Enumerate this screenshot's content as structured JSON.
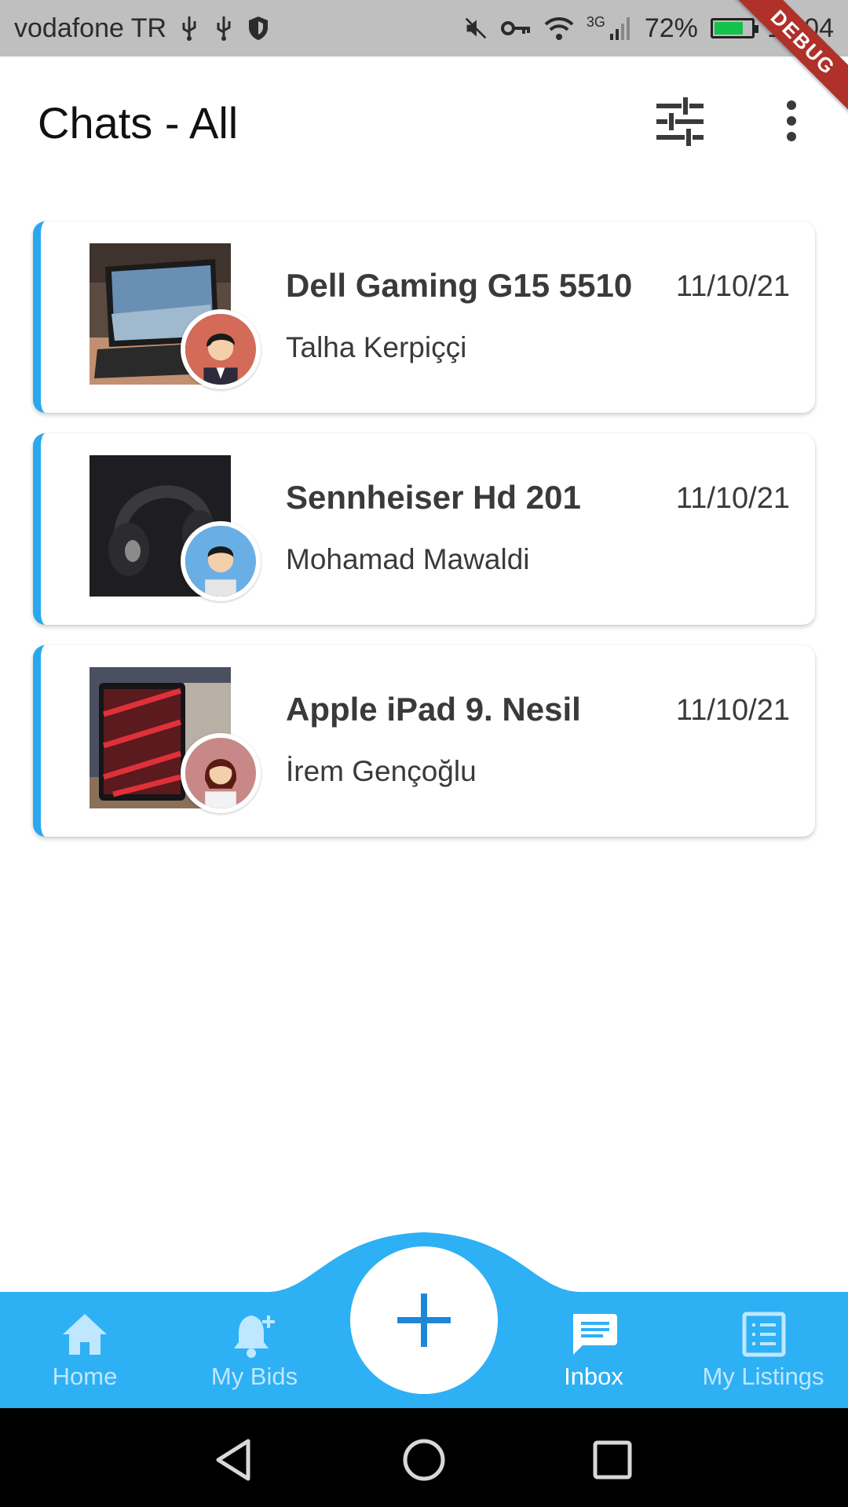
{
  "status_bar": {
    "carrier": "vodafone TR",
    "network": "3G",
    "battery_percent": "72%",
    "time": "19:04",
    "debug_label": "DEBUG"
  },
  "header": {
    "title": "Chats - All",
    "filter_icon": "tune-icon",
    "more_icon": "more-vert-icon"
  },
  "chats": [
    {
      "title": "Dell Gaming G15 5510",
      "user": "Talha Kerpiççi",
      "date": "11/10/21"
    },
    {
      "title": "Sennheiser Hd 201",
      "user": "Mohamad Mawaldi",
      "date": "11/10/21"
    },
    {
      "title": "Apple iPad 9. Nesil",
      "user": "İrem Gençoğlu",
      "date": "11/10/21"
    }
  ],
  "bottom_nav": {
    "items": [
      {
        "label": "Home",
        "icon": "home-icon"
      },
      {
        "label": "My Bids",
        "icon": "bell-plus-icon"
      },
      {
        "label": "Inbox",
        "icon": "chat-icon",
        "active": true
      },
      {
        "label": "My Listings",
        "icon": "list-icon"
      }
    ],
    "fab_icon": "plus-icon"
  },
  "colors": {
    "accent": "#2aa8ee",
    "nav_bg": "#2eb0f5",
    "fab_plus": "#1e88d8"
  }
}
